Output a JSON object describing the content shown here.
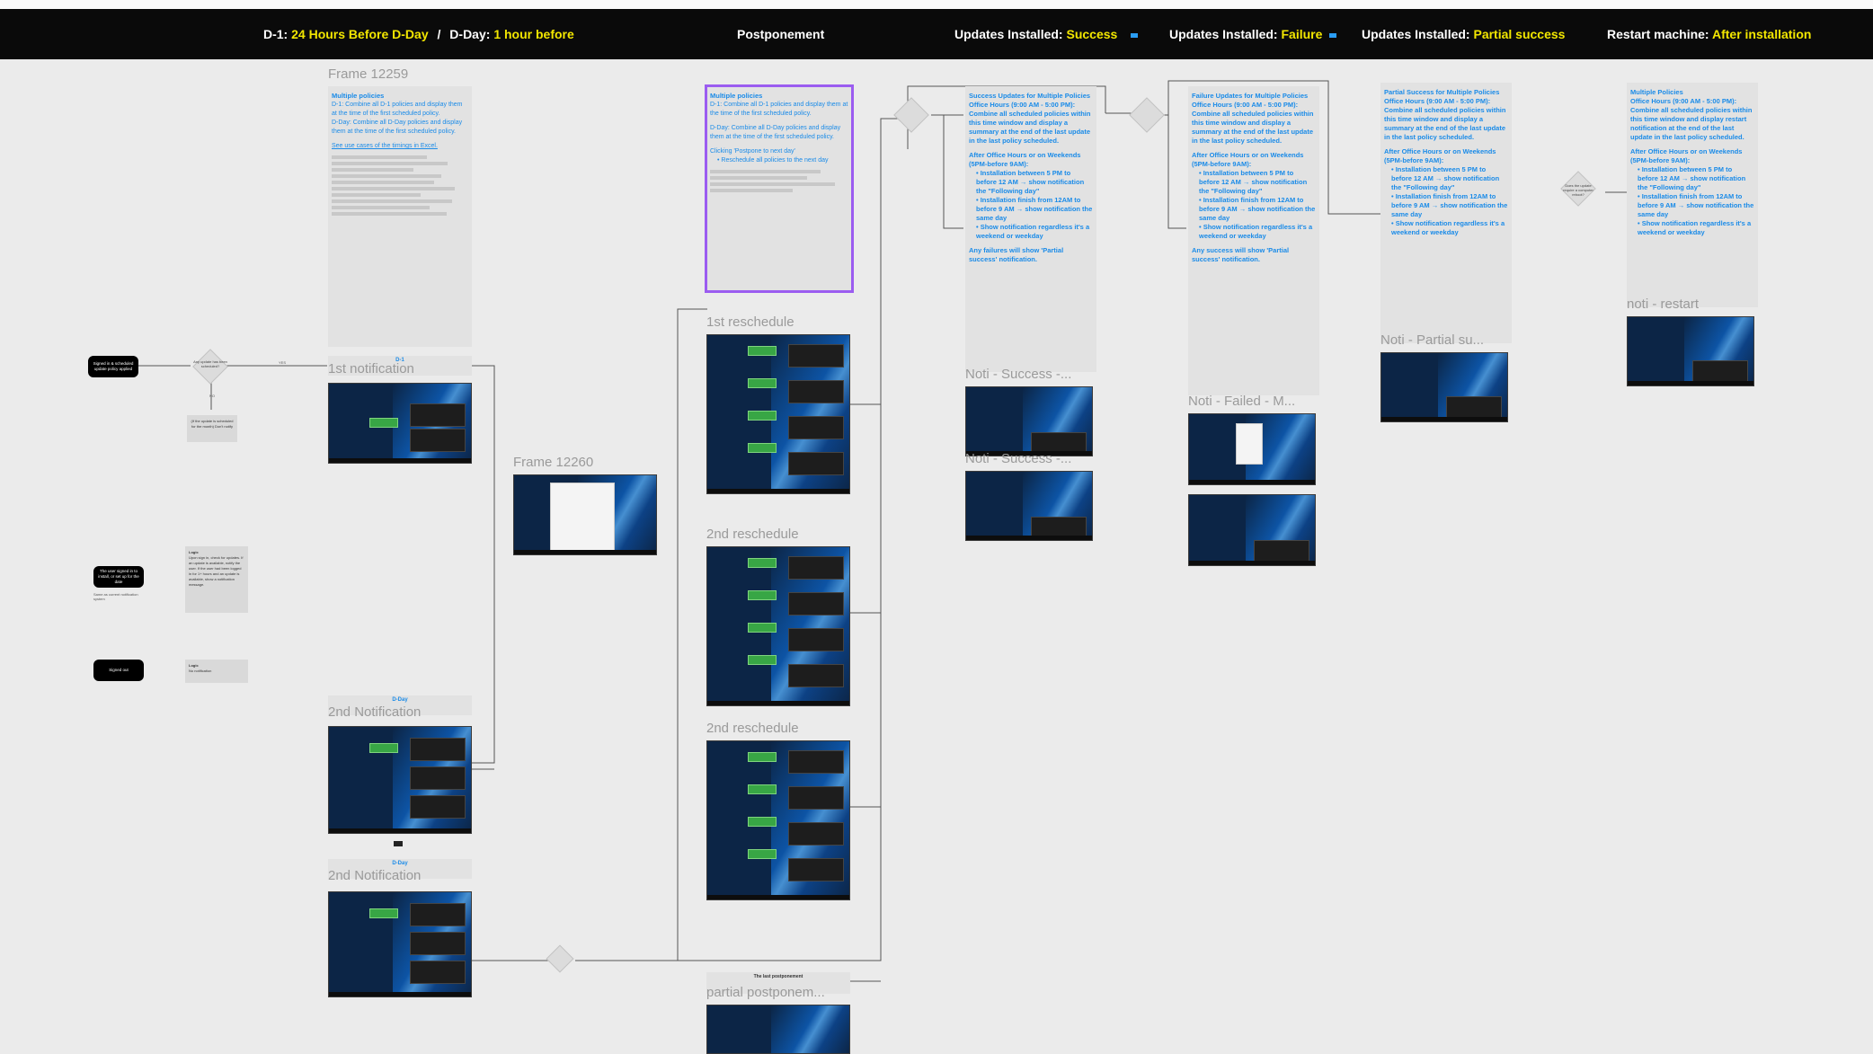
{
  "header": {
    "d1_label": "D-1:",
    "d1_value": "24 Hours Before D-Day",
    "slash": "/",
    "dday_label": "D-Day:",
    "dday_value": "1 hour before",
    "postponement": "Postponement",
    "success_label": "Updates Installed:",
    "success_value": "Success",
    "failure_label": "Updates Installed:",
    "failure_value": "Failure",
    "partial_label": "Updates Installed:",
    "partial_value": "Partial success",
    "restart_label": "Restart machine:",
    "restart_value": "After installation"
  },
  "frames": {
    "frame_12259": "Frame 12259",
    "first_notification": "1st notification",
    "frame_12260": "Frame 12260",
    "second_notification_a": "2nd Notification",
    "second_notification_b": "2nd Notification",
    "first_reschedule": "1st reschedule",
    "second_reschedule_a": "2nd reschedule",
    "second_reschedule_b": "2nd reschedule",
    "partial_postponement": "partial postponem...",
    "noti_success": "Noti - Success -...",
    "noti_success_2": "Noti - Success -...",
    "noti_failed": "Noti - Failed - M...",
    "noti_partial": "Noti - Partial su...",
    "noti_restart": "noti - restart"
  },
  "notes": {
    "multi_d1": {
      "title": "Multiple policies",
      "d1": "D-1: Combine all D-1 policies and display them at the time of the first scheduled policy.",
      "dday": "D-Day: Combine all D-Day policies and display them at the time of the first scheduled policy.",
      "link": "See use cases of the timings in Excel."
    },
    "postponement": {
      "title": "Multiple policies",
      "d1": "D-1: Combine all D-1 policies and display them at the time of the first scheduled policy.",
      "dday": "D-Day: Combine all D-Day policies and display them at the time of the first scheduled policy.",
      "clicking": "Clicking 'Postpone to next day'",
      "bullet": "Reschedule all policies to the next day"
    },
    "success": {
      "title": "Success Updates for Multiple Policies",
      "office": "Office Hours (9:00 AM - 5:00 PM): Combine all scheduled policies within this time window and display a summary at the end of the last update in the last policy scheduled.",
      "after": "After Office Hours or on Weekends (5PM-before 9AM):",
      "b1": "Installation between 5 PM to before 12 AM → show notification the \"Following day\"",
      "b2": "Installation finish from 12AM to before 9 AM → show notification the same day",
      "b3": "Show notification regardless it's a weekend or weekday",
      "footer": "Any failures will show 'Partial success' notification."
    },
    "failure": {
      "title": "Failure Updates for Multiple Policies",
      "office": "Office Hours (9:00 AM - 5:00 PM): Combine all scheduled policies within this time window and display a summary at the end of the last update in the last policy scheduled.",
      "after": "After Office Hours or on Weekends (5PM-before 9AM):",
      "b1": "Installation between 5 PM to before 12 AM → show notification the \"Following day\"",
      "b2": "Installation finish from 12AM to before 9 AM → show notification the same day",
      "b3": "Show notification regardless it's a weekend or weekday",
      "footer": "Any success will show 'Partial success' notification."
    },
    "partial": {
      "title": "Partial Success for Multiple Policies",
      "office": "Office Hours (9:00 AM - 5:00 PM): Combine all scheduled policies within this time window and display a summary at the end of the last update in the last policy scheduled.",
      "after": "After Office Hours or on Weekends (5PM-before 9AM):",
      "b1": "Installation between 5 PM to before 12 AM → show notification the \"Following day\"",
      "b2": "Installation finish from 12AM to before 9 AM → show notification the same day",
      "b3": "Show notification regardless it's a weekend or weekday"
    },
    "restart": {
      "title": "Multiple Policies",
      "office": "Office Hours (9:00 AM - 5:00 PM): Combine all scheduled policies within this time window and display restart notification at the end of the last update in the last policy scheduled.",
      "after": "After Office Hours or on Weekends (5PM-before 9AM):",
      "b1": "Installation between 5 PM to before 12 AM → show notification the \"Following day\"",
      "b2": "Installation finish from 12AM to before 9 AM → show notification the same day",
      "b3": "Show notification regardless it's a weekend or weekday"
    }
  },
  "sub_labels": {
    "d1_row": "D-1",
    "dday_row_a": "D-Day",
    "dday_row_b": "D-Day",
    "last_postponement": "The last postponement"
  },
  "flow": {
    "start_pill": "Signed in & scheduled update policy applied",
    "decision_1": "Any update has been scheduled?",
    "yes": "YES",
    "no": "NO",
    "no_update_box": "(If the update is scheduled for the month) Don't notify",
    "pill_2": "The user signed in to install, or set up for the date",
    "pill_2_caption": "Same as current notification system",
    "pill_3": "Signed out",
    "logic_1_title": "Logic",
    "logic_1": "Upon sign in, check for updates. If an update is available, notify the user. If the user had been logged in for 1+ hours and an update is available, show a notification message.",
    "logic_2_title": "Logic",
    "logic_2": "No notification",
    "restart_decision": "Does the update require a computer reboot?"
  },
  "colors": {
    "accent_yellow": "#f2e600",
    "note_blue": "#1a8be8",
    "selection_purple": "#9b5cf0",
    "bar_black": "#0a0a0a"
  }
}
